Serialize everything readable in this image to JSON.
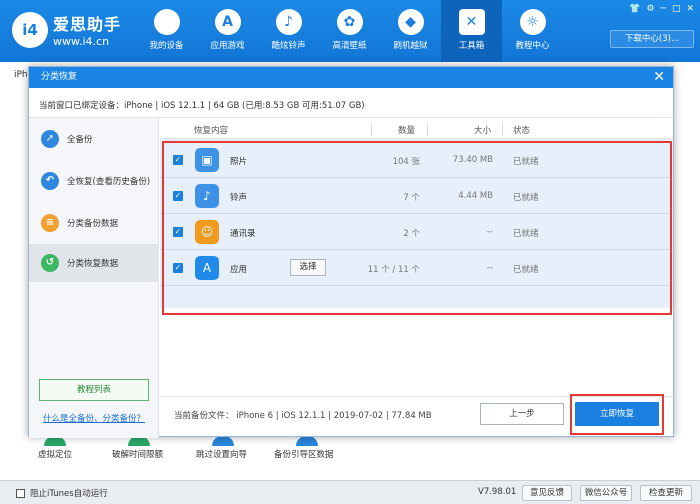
{
  "app": {
    "logo_mark": "i4",
    "name": "爱思助手",
    "url": "www.i4.cn",
    "download_label": "下载中心(3)..."
  },
  "nav": [
    {
      "label": "我的设备",
      "icon": "apple-icon",
      "glyph": ""
    },
    {
      "label": "应用游戏",
      "icon": "app-store-icon",
      "glyph": "A"
    },
    {
      "label": "酷炫铃声",
      "icon": "bell-icon",
      "glyph": "♪"
    },
    {
      "label": "高清壁纸",
      "icon": "flower-icon",
      "glyph": "✿"
    },
    {
      "label": "刷机越狱",
      "icon": "dropbox-icon",
      "glyph": "◆"
    },
    {
      "label": "工具箱",
      "icon": "tools-icon",
      "glyph": "✕"
    },
    {
      "label": "教程中心",
      "icon": "lightbulb-icon",
      "glyph": "☼"
    }
  ],
  "background": {
    "iph_text": "iPh",
    "tools": [
      "虚拟定位",
      "破解时间限额",
      "跳过设置向导",
      "备份引导区数据"
    ]
  },
  "dialog": {
    "title": "分类恢复",
    "device_info": "当前窗口已绑定设备：iPhone  |  iOS 12.1.1  |  64 GB (已用:8.53 GB 可用:51.07 GB)",
    "sidebar": [
      {
        "label": "全备份",
        "icon": "full-backup-icon",
        "color": "#2f86dd",
        "glyph": "➚"
      },
      {
        "label": "全恢复(查看历史备份)",
        "icon": "full-restore-icon",
        "color": "#2f86dd",
        "glyph": "↶"
      },
      {
        "label": "分类备份数据",
        "icon": "category-backup-icon",
        "color": "#f0a030",
        "glyph": "≡"
      },
      {
        "label": "分类恢复数据",
        "icon": "category-restore-icon",
        "color": "#3cb863",
        "glyph": "↺"
      }
    ],
    "tutorial_label": "教程列表",
    "help_link": "什么是全备份、分类备份？",
    "columns": {
      "content": "恢复内容",
      "count": "数量",
      "size": "大小",
      "status": "状态"
    },
    "rows": [
      {
        "name": "照片",
        "count": "104 张",
        "size": "73.40 MB",
        "status": "已就绪",
        "icon": "photos-icon",
        "color": "#3d92e6",
        "glyph": "▣"
      },
      {
        "name": "铃声",
        "count": "7 个",
        "size": "4.44 MB",
        "status": "已就绪",
        "icon": "bell-icon",
        "color": "#3d92e6",
        "glyph": "♪"
      },
      {
        "name": "通讯录",
        "count": "2 个",
        "size": "--",
        "status": "已就绪",
        "icon": "contacts-icon",
        "color": "#f29a1d",
        "glyph": "☺"
      },
      {
        "name": "应用",
        "count": "11 个 / 11 个",
        "size": "--",
        "status": "已就绪",
        "icon": "app-store-icon",
        "color": "#1f8ae8",
        "glyph": "A"
      }
    ],
    "select_label": "选择",
    "footer_info": "当前备份文件：  iPhone 6  |  iOS 12.1.1  |  2019-07-02  |  77.84 MB",
    "prev_label": "上一步",
    "restore_label": "立即恢复"
  },
  "statusbar": {
    "itunes_label": "阻止iTunes自动运行",
    "version": "V7.98.01",
    "buttons": [
      "意见反馈",
      "微信公众号",
      "检查更新"
    ]
  }
}
